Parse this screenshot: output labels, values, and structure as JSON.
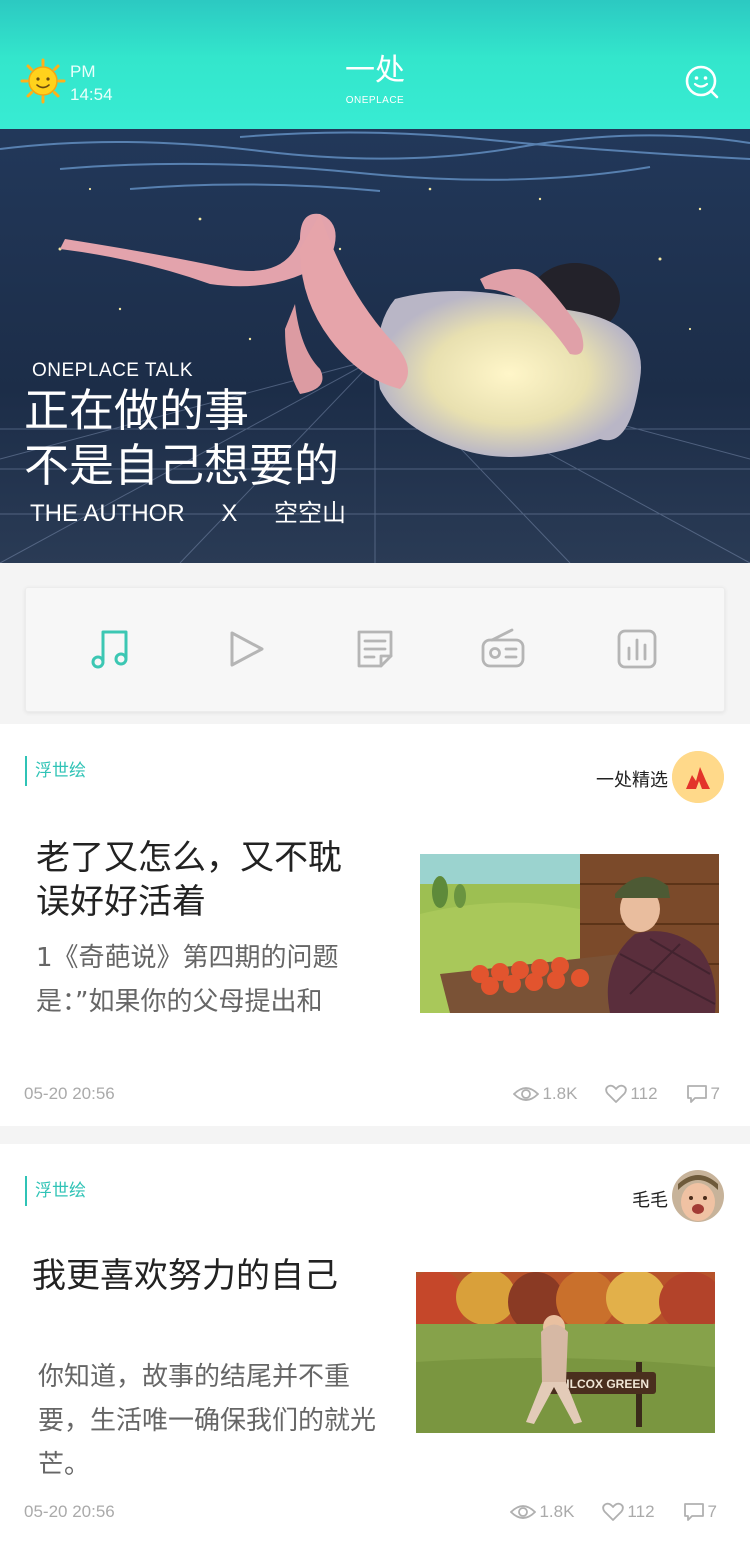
{
  "header": {
    "weather_icon": "sun-icon",
    "ampm": "PM",
    "time": "14:54",
    "brand_cn": "一处",
    "brand_en": "ONEPLACE",
    "search_icon": "search-face-icon",
    "accent": "#36e8cf"
  },
  "hero": {
    "subtitle": "ONEPLACE TALK",
    "title_line1": "正在做的事",
    "title_line2": "不是自己想要的",
    "credit_author": "THE AUTHOR",
    "credit_x": "X",
    "credit_name": "空空山"
  },
  "categories": {
    "items": [
      {
        "icon": "music-note-icon",
        "active": true
      },
      {
        "icon": "play-icon",
        "active": false
      },
      {
        "icon": "article-icon",
        "active": false
      },
      {
        "icon": "radio-icon",
        "active": false
      },
      {
        "icon": "chart-icon",
        "active": false
      }
    ],
    "active_color": "#3cc7b3",
    "inactive_color": "#b5b5b5"
  },
  "feed": [
    {
      "tag": "浮世绘",
      "author": "一处精选",
      "title": "老了又怎么，又不耽误好好活着",
      "excerpt": "1《奇葩说》第四期的问题是：”如果你的父母提出和",
      "date": "05-20 20:56",
      "views": "1.8K",
      "likes": "112",
      "comments": "7"
    },
    {
      "tag": "浮世绘",
      "author": "毛毛",
      "title": "我更喜欢努力的自己",
      "excerpt": "你知道，故事的结尾并不重要，生活唯一确保我们的就光芒。",
      "sign_text": "WILCOX GREEN",
      "date": "05-20 20:56",
      "views": "1.8K",
      "likes": "112",
      "comments": "7"
    }
  ]
}
